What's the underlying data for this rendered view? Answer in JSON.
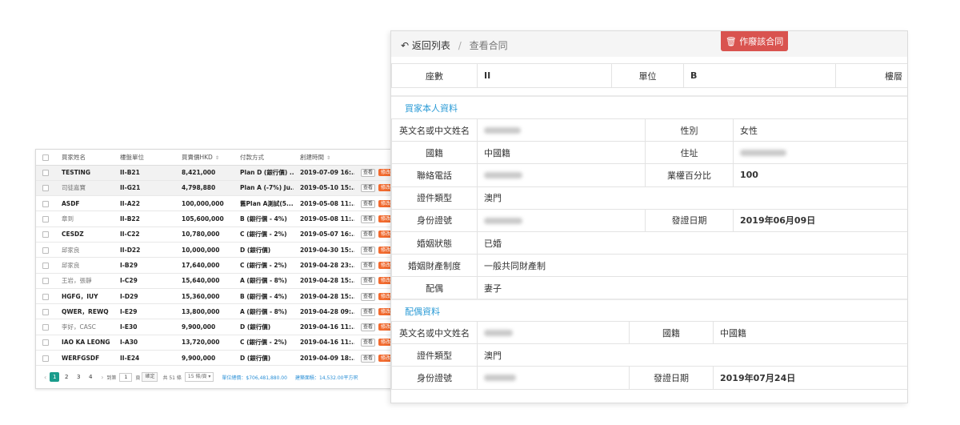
{
  "list": {
    "headers": [
      "買家姓名",
      "樓盤單位",
      "買賣價HKD",
      "付款方式",
      "創建時間"
    ],
    "view_label": "查看",
    "edit_label": "修改",
    "rows": [
      {
        "name": "TESTING",
        "unit": "II-B21",
        "price": "8,421,000",
        "payment": "Plan D (銀行價) ...",
        "created": "2019-07-09 16:..."
      },
      {
        "name": "司徒嘉寶",
        "unit": "II-G21",
        "price": "4,798,880",
        "payment": "Plan A (-7%) Ju...",
        "created": "2019-05-10 15:..."
      },
      {
        "name": "ASDF",
        "unit": "II-A22",
        "price": "100,000,000",
        "payment": "舊Plan A測試(5...",
        "created": "2019-05-08 11:..."
      },
      {
        "name": "章到",
        "unit": "II-B22",
        "price": "105,600,000",
        "payment": "B (銀行價 - 4%)",
        "created": "2019-05-08 11:..."
      },
      {
        "name": "CESDZ",
        "unit": "II-C22",
        "price": "10,780,000",
        "payment": "C (銀行價 - 2%)",
        "created": "2019-05-07 16:..."
      },
      {
        "name": "邱家良",
        "unit": "II-D22",
        "price": "10,000,000",
        "payment": "D (銀行價)",
        "created": "2019-04-30 15:..."
      },
      {
        "name": "邱家良",
        "unit": "I-B29",
        "price": "17,640,000",
        "payment": "C (銀行價 - 2%)",
        "created": "2019-04-28 23:..."
      },
      {
        "name": "王岩，張靜",
        "unit": "I-C29",
        "price": "15,640,000",
        "payment": "A (銀行價 - 8%)",
        "created": "2019-04-28 15:..."
      },
      {
        "name": "HGFG，IUY",
        "unit": "I-D29",
        "price": "15,360,000",
        "payment": "B (銀行價 - 4%)",
        "created": "2019-04-28 15:..."
      },
      {
        "name": "QWER，REWQ",
        "unit": "I-E29",
        "price": "13,800,000",
        "payment": "A (銀行價 - 8%)",
        "created": "2019-04-28 09:..."
      },
      {
        "name": "李好，CASC",
        "unit": "I-E30",
        "price": "9,900,000",
        "payment": "D (銀行價)",
        "created": "2019-04-16 11:..."
      },
      {
        "name": "IAO KA LEONG",
        "unit": "I-A30",
        "price": "13,720,000",
        "payment": "C (銀行價 - 2%)",
        "created": "2019-04-16 11:..."
      },
      {
        "name": "WERFGSDF",
        "unit": "II-E24",
        "price": "9,900,000",
        "payment": "D (銀行價)",
        "created": "2019-04-09 18:..."
      }
    ],
    "pagination": {
      "pages": [
        "1",
        "2",
        "3",
        "4"
      ],
      "goto_label": "到第",
      "goto_value": "1",
      "page_unit": "頁",
      "confirm_label": "確定",
      "total": "共 51 條",
      "page_size": "15 條/頁",
      "sum_price": "單位總價：$706,481,880.00",
      "sum_area": "建築面積：14,532.00平方呎"
    }
  },
  "detail": {
    "breadcrumb": {
      "back": "返回列表",
      "current": "查看合同"
    },
    "void_button": "作廢該合同",
    "unit_row": {
      "seat_label": "座數",
      "seat_value": "II",
      "unit_label": "單位",
      "unit_value": "B",
      "floor_label": "樓層"
    },
    "buyer": {
      "title": "買家本人資料",
      "name_label": "英文名或中文姓名",
      "gender_label": "性別",
      "gender_value": "女性",
      "nationality_label": "國籍",
      "nationality_value": "中國籍",
      "address_label": "住址",
      "phone_label": "聯絡電話",
      "share_label": "業權百分比",
      "share_value": "100",
      "doc_type_label": "證件類型",
      "doc_type_value": "澳門",
      "id_label": "身份證號",
      "issue_date_label": "發證日期",
      "issue_date_value": "2019年06月09日",
      "marital_label": "婚姻狀態",
      "marital_value": "已婚",
      "property_label": "婚姻財產制度",
      "property_value": "一般共同財產制",
      "spouse_label": "配偶",
      "spouse_value": "妻子"
    },
    "spouse": {
      "title": "配偶資料",
      "name_label": "英文名或中文姓名",
      "nationality_label": "國籍",
      "nationality_value": "中國籍",
      "doc_type_label": "證件類型",
      "doc_type_value": "澳門",
      "id_label": "身份證號",
      "issue_date_label": "發證日期",
      "issue_date_value": "2019年07月24日"
    }
  },
  "colors": {
    "accent_teal": "#1a9c8c",
    "danger": "#d9534f",
    "section_blue": "#2b9bd6",
    "edit_orange": "#f26a2e"
  }
}
